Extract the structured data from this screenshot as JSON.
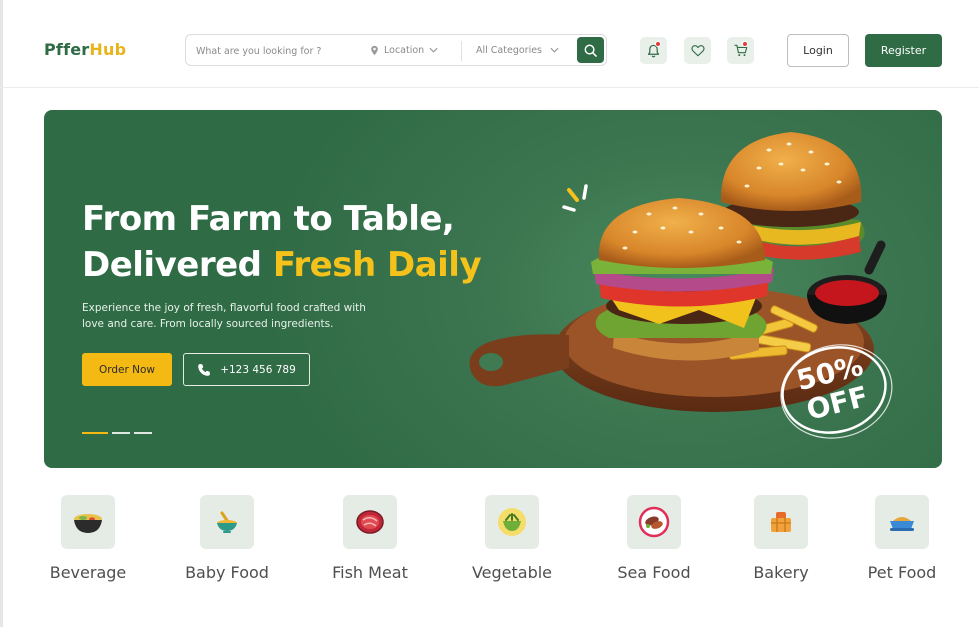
{
  "brand": {
    "part1": "Pffer",
    "part2": "Hub",
    "colors": {
      "primary": "#2f6b45",
      "accent": "#f5b914"
    }
  },
  "search": {
    "placeholder": "What are you looking for ?",
    "location_label": "Location",
    "category_label": "All Categories"
  },
  "header_icons": [
    {
      "name": "bell-icon",
      "badge": true
    },
    {
      "name": "heart-icon",
      "badge": false
    },
    {
      "name": "cart-icon",
      "badge": true
    }
  ],
  "auth": {
    "login_label": "Login",
    "register_label": "Register"
  },
  "hero": {
    "title_line1": "From Farm to Table,",
    "title_line2_white": "Delivered ",
    "title_line2_highlight": "Fresh Daily",
    "subtitle": "Experience the joy of fresh, flavorful food crafted with love and care. From locally sourced ingredients.",
    "order_label": "Order Now",
    "phone": "+123 456 789",
    "badge_line1": "50%",
    "badge_line2": "OFF",
    "slides": {
      "count": 3,
      "active": 1
    }
  },
  "categories": [
    {
      "label": "Beverage",
      "icon": "bowl-icon"
    },
    {
      "label": "Baby Food",
      "icon": "baby-bowl-icon"
    },
    {
      "label": "Fish Meat",
      "icon": "meat-icon"
    },
    {
      "label": "Vegetable",
      "icon": "salad-bowl-icon"
    },
    {
      "label": "Sea Food",
      "icon": "plate-icon"
    },
    {
      "label": "Bakery",
      "icon": "bread-basket-icon"
    },
    {
      "label": "Pet Food",
      "icon": "pet-bowl-icon"
    }
  ]
}
